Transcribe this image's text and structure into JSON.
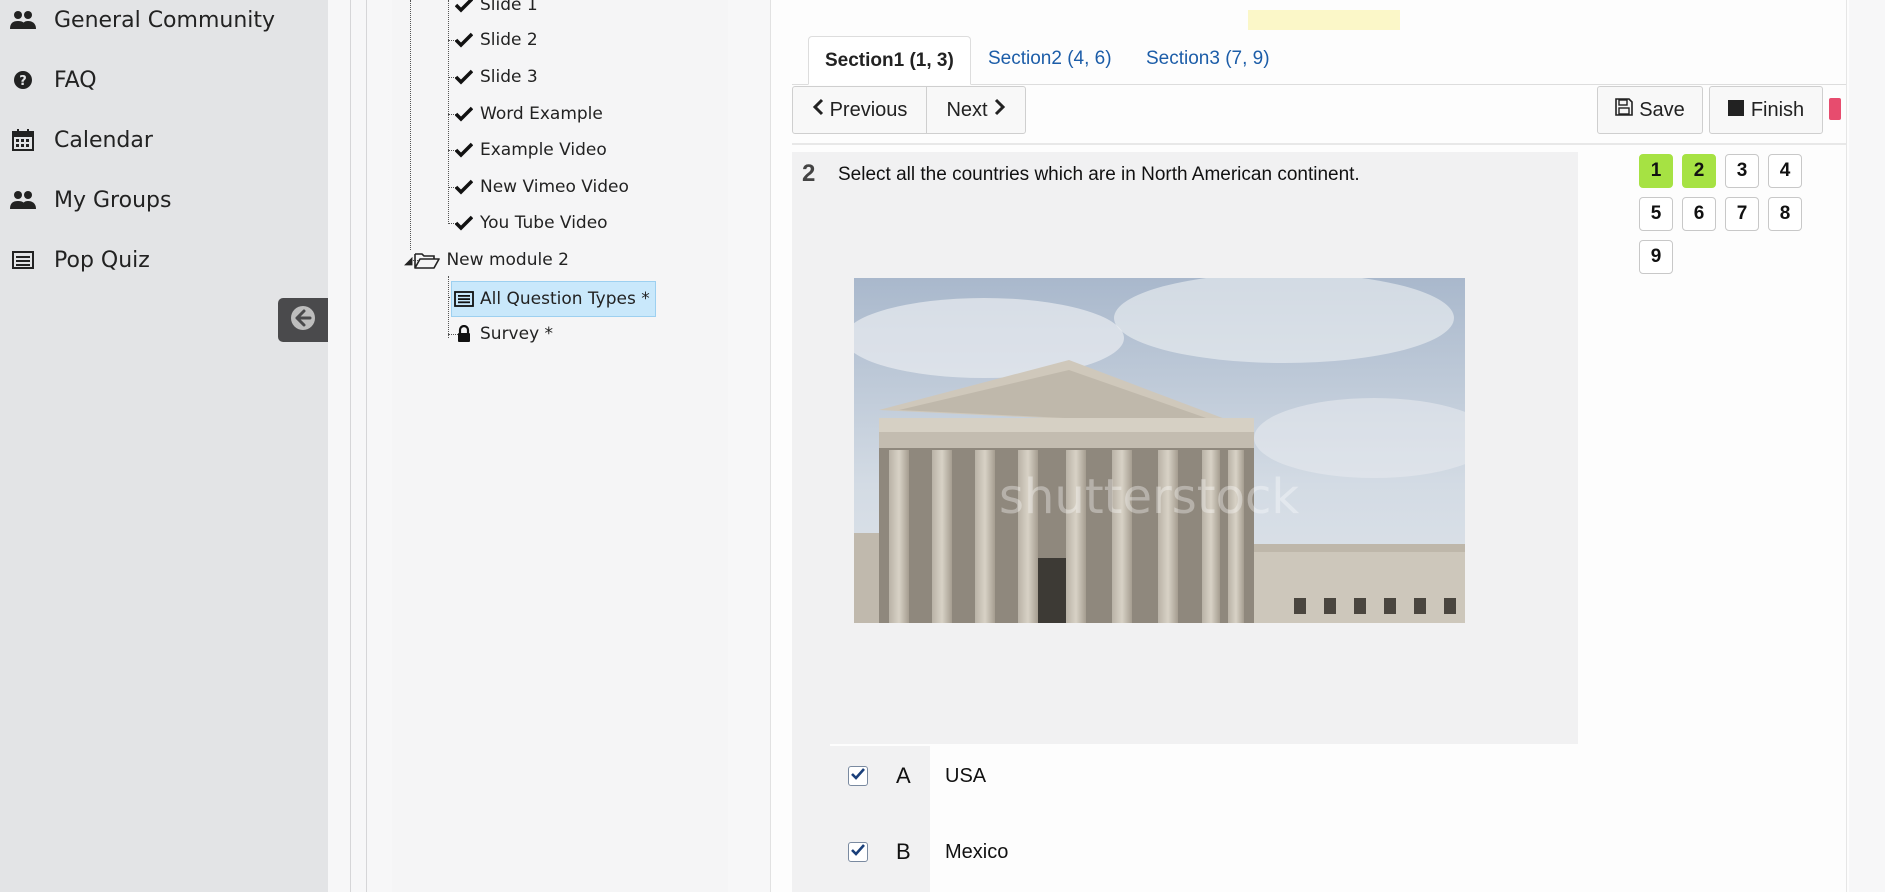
{
  "sidebar": {
    "items": [
      {
        "label": "General Community",
        "icon": "users-icon"
      },
      {
        "label": "FAQ",
        "icon": "question-circle-icon"
      },
      {
        "label": "Calendar",
        "icon": "calendar-icon"
      },
      {
        "label": "My Groups",
        "icon": "users-icon"
      },
      {
        "label": "Pop Quiz",
        "icon": "list-alt-icon"
      }
    ],
    "collapse_icon": "arrow-circle-left-icon"
  },
  "tree": {
    "items": [
      {
        "label": "Slide 1",
        "icon": "check-icon"
      },
      {
        "label": "Slide 2",
        "icon": "check-icon"
      },
      {
        "label": "Slide 3",
        "icon": "check-icon"
      },
      {
        "label": "Word Example",
        "icon": "check-icon"
      },
      {
        "label": "Example Video",
        "icon": "check-icon"
      },
      {
        "label": "New Vimeo Video",
        "icon": "check-icon"
      },
      {
        "label": "You Tube Video",
        "icon": "check-icon"
      },
      {
        "label": "New module 2",
        "icon": "folder-open-icon"
      },
      {
        "label": "All Question Types *",
        "icon": "list-alt-icon",
        "selected": true
      },
      {
        "label": "Survey *",
        "icon": "lock-icon"
      }
    ]
  },
  "tabs": [
    {
      "label": "Section1 (1, 3)",
      "active": true
    },
    {
      "label": "Section2 (4, 6)",
      "active": false
    },
    {
      "label": "Section3 (7, 9)",
      "active": false
    }
  ],
  "toolbar": {
    "previous_label": "Previous",
    "next_label": "Next",
    "save_label": "Save",
    "finish_label": "Finish"
  },
  "question": {
    "number": "2",
    "text": "Select all the countries which are in North American continent.",
    "image_watermark": "shutterstock",
    "answers": [
      {
        "letter": "A",
        "text": "USA",
        "checked": true
      },
      {
        "letter": "B",
        "text": "Mexico",
        "checked": true
      }
    ]
  },
  "question_nav": {
    "items": [
      {
        "label": "1",
        "done": true
      },
      {
        "label": "2",
        "done": true
      },
      {
        "label": "3",
        "done": false
      },
      {
        "label": "4",
        "done": false
      },
      {
        "label": "5",
        "done": false
      },
      {
        "label": "6",
        "done": false
      },
      {
        "label": "7",
        "done": false
      },
      {
        "label": "8",
        "done": false
      },
      {
        "label": "9",
        "done": false
      }
    ],
    "done_color": "#a6e243"
  },
  "colors": {
    "tab_link": "#1c5da8",
    "selected_tree_bg": "#c9e8fb",
    "flag_red": "#e74c6e"
  }
}
